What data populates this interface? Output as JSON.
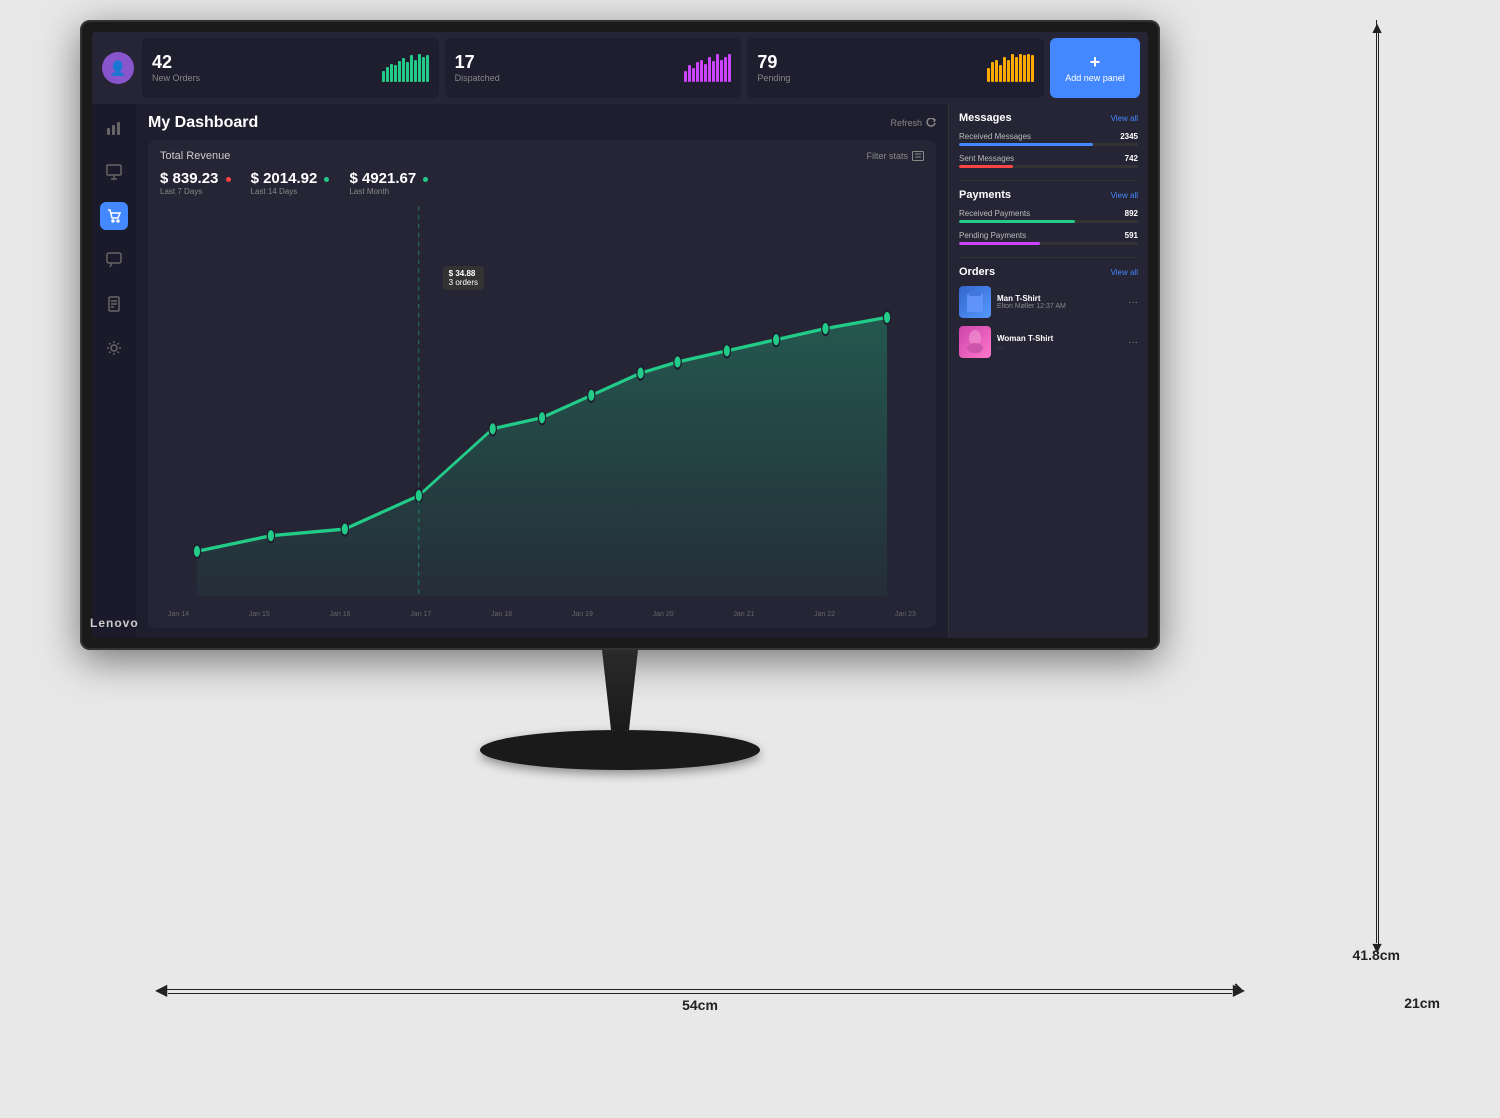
{
  "monitor": {
    "brand": "Lenovo",
    "dimensions": {
      "width": "54cm",
      "height": "41.8cm",
      "depth": "21cm"
    }
  },
  "top_bar": {
    "stats": [
      {
        "number": "42",
        "label": "New Orders",
        "color": "#22cc88",
        "bars": [
          3,
          5,
          7,
          6,
          8,
          9,
          7,
          10,
          8,
          11,
          9,
          12,
          10,
          11
        ]
      },
      {
        "number": "17",
        "label": "Dispatched",
        "color": "#cc44ff",
        "bars": [
          4,
          6,
          5,
          7,
          8,
          6,
          9,
          7,
          10,
          8,
          9,
          11,
          10,
          12
        ]
      },
      {
        "number": "79",
        "label": "Pending",
        "color": "#ffaa00",
        "bars": [
          5,
          7,
          8,
          6,
          9,
          8,
          10,
          9,
          11,
          10,
          12,
          11,
          13,
          12
        ]
      }
    ],
    "add_panel": {
      "plus": "+",
      "label": "Add new panel"
    }
  },
  "sidebar": {
    "items": [
      {
        "name": "chart-icon",
        "symbol": "📊",
        "active": false
      },
      {
        "name": "presentation-icon",
        "symbol": "🖥",
        "active": false
      },
      {
        "name": "shopping-icon",
        "symbol": "🛒",
        "active": true
      },
      {
        "name": "chat-icon",
        "symbol": "💬",
        "active": false
      },
      {
        "name": "document-icon",
        "symbol": "📄",
        "active": false
      },
      {
        "name": "settings-icon",
        "symbol": "⚙",
        "active": false
      }
    ]
  },
  "dashboard": {
    "title": "My Dashboard",
    "refresh_label": "Refresh",
    "revenue": {
      "title": "Total Revenue",
      "filter_label": "Filter stats",
      "items": [
        {
          "value": "$ 839.23",
          "period": "Last 7 Days",
          "dot_color": "#ff4444"
        },
        {
          "value": "$ 2014.92",
          "period": "Last 14 Days",
          "dot_color": "#22cc88"
        },
        {
          "value": "$ 4921.67",
          "period": "Last Month",
          "dot_color": "#22cc88"
        }
      ],
      "tooltip": {
        "price": "$ 34.88",
        "orders": "3 orders"
      },
      "x_labels": [
        "Jan 14",
        "Jan 15",
        "Jan 16",
        "Jan 17",
        "Jan 18",
        "Jan 19",
        "Jan 20",
        "Jan 21",
        "Jan 22",
        "Jan 23"
      ]
    }
  },
  "right_panel": {
    "messages": {
      "title": "Messages",
      "view_all": "View all",
      "received": {
        "label": "Received Messages",
        "count": "2345",
        "color": "#4488ff",
        "percent": 75
      },
      "sent": {
        "label": "Sent Messages",
        "count": "742",
        "color": "#ff4444",
        "percent": 30
      }
    },
    "payments": {
      "title": "Payments",
      "view_all": "View all",
      "received": {
        "label": "Received Payments",
        "count": "892",
        "color": "#22cc88",
        "percent": 65
      },
      "pending": {
        "label": "Pending Payments",
        "count": "591",
        "color": "#cc44ff",
        "percent": 45
      }
    },
    "orders": {
      "title": "Orders",
      "view_all": "View all",
      "items": [
        {
          "name": "Man T-Shirt",
          "sub": "Elton Møller  12:37 AM",
          "thumb_color": "#3366cc"
        },
        {
          "name": "Woman T-Shirt",
          "sub": "...",
          "thumb_color": "#cc44aa"
        }
      ]
    }
  }
}
